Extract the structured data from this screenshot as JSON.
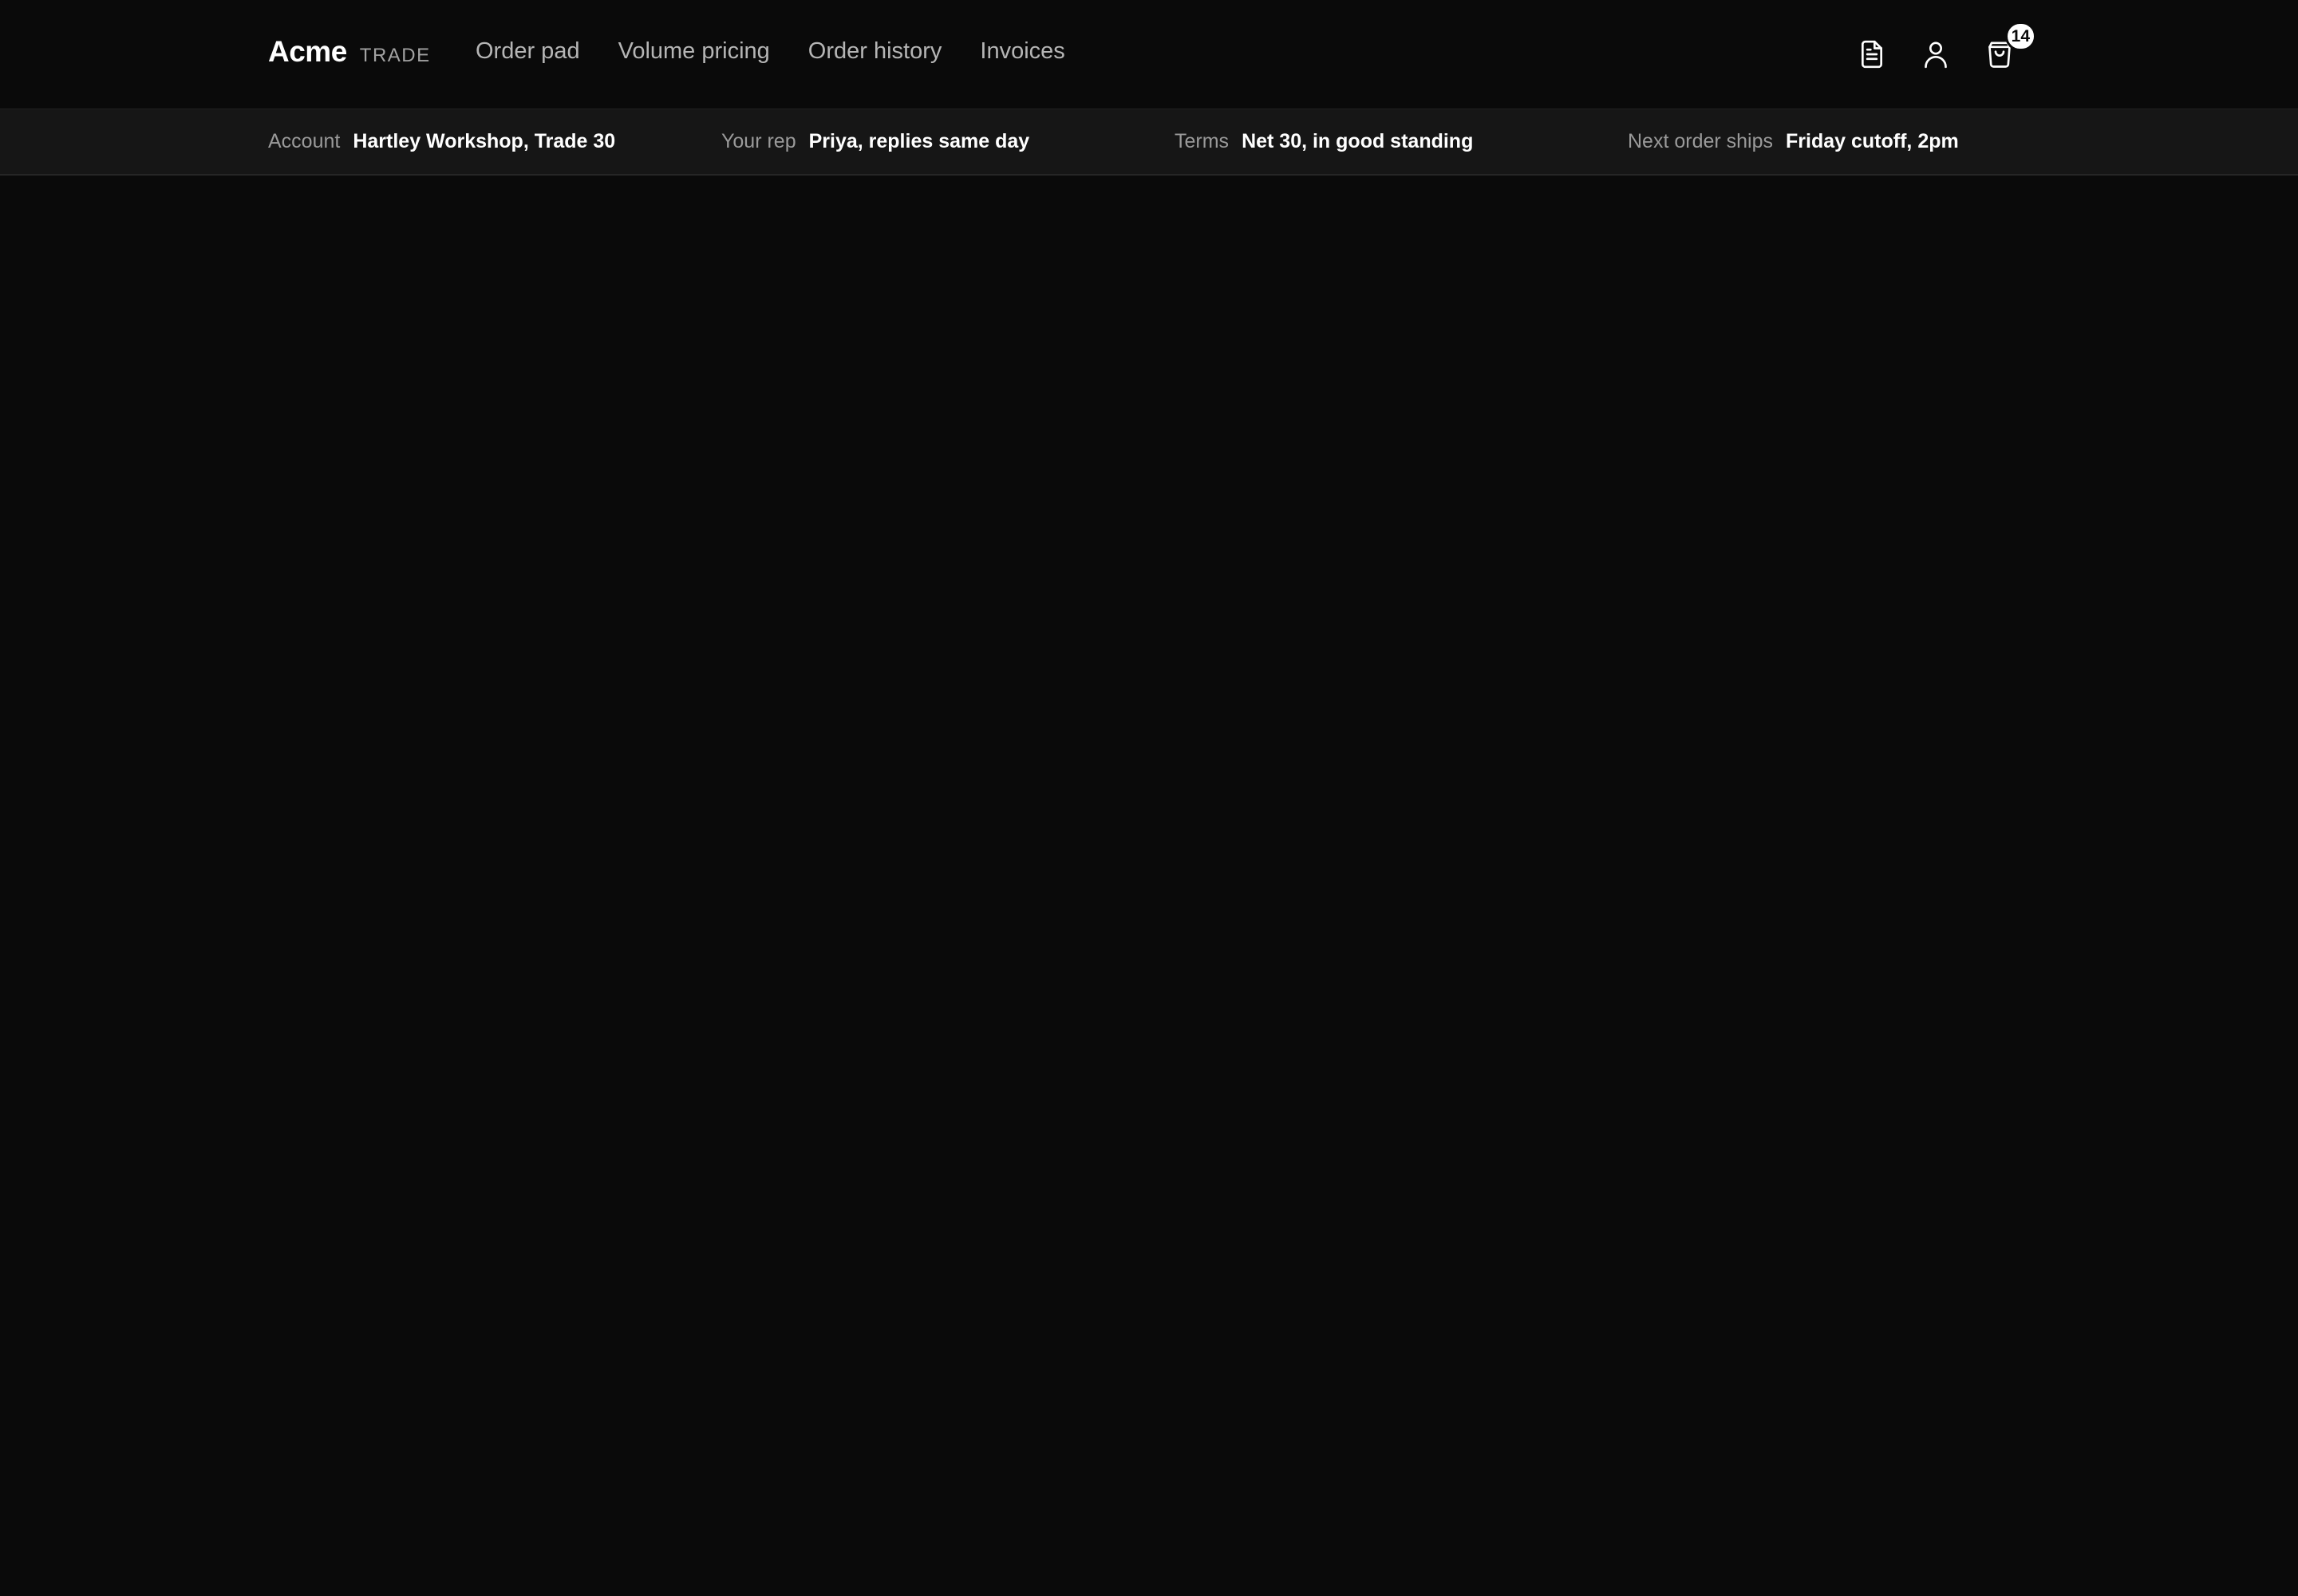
{
  "brand": {
    "name": "Acme",
    "tag": "TRADE"
  },
  "nav": {
    "items": [
      {
        "label": "Order pad"
      },
      {
        "label": "Volume pricing"
      },
      {
        "label": "Order history"
      },
      {
        "label": "Invoices"
      }
    ]
  },
  "header_icons": {
    "document": "document-icon",
    "account": "user-icon",
    "cart": "shopping-bag-icon",
    "cart_count": "14"
  },
  "infobar": {
    "account": {
      "label": "Account",
      "value": "Hartley Workshop, Trade 30"
    },
    "rep": {
      "label": "Your rep",
      "value": "Priya, replies same day"
    },
    "terms": {
      "label": "Terms",
      "value": "Net 30, in good standing"
    },
    "shipping": {
      "label": "Next order ships",
      "value": "Friday cutoff, 2pm"
    }
  },
  "colors": {
    "background": "#0a0a0a",
    "infobar_background": "#161616",
    "text_primary": "#ffffff",
    "text_muted": "#9a9a9a"
  }
}
